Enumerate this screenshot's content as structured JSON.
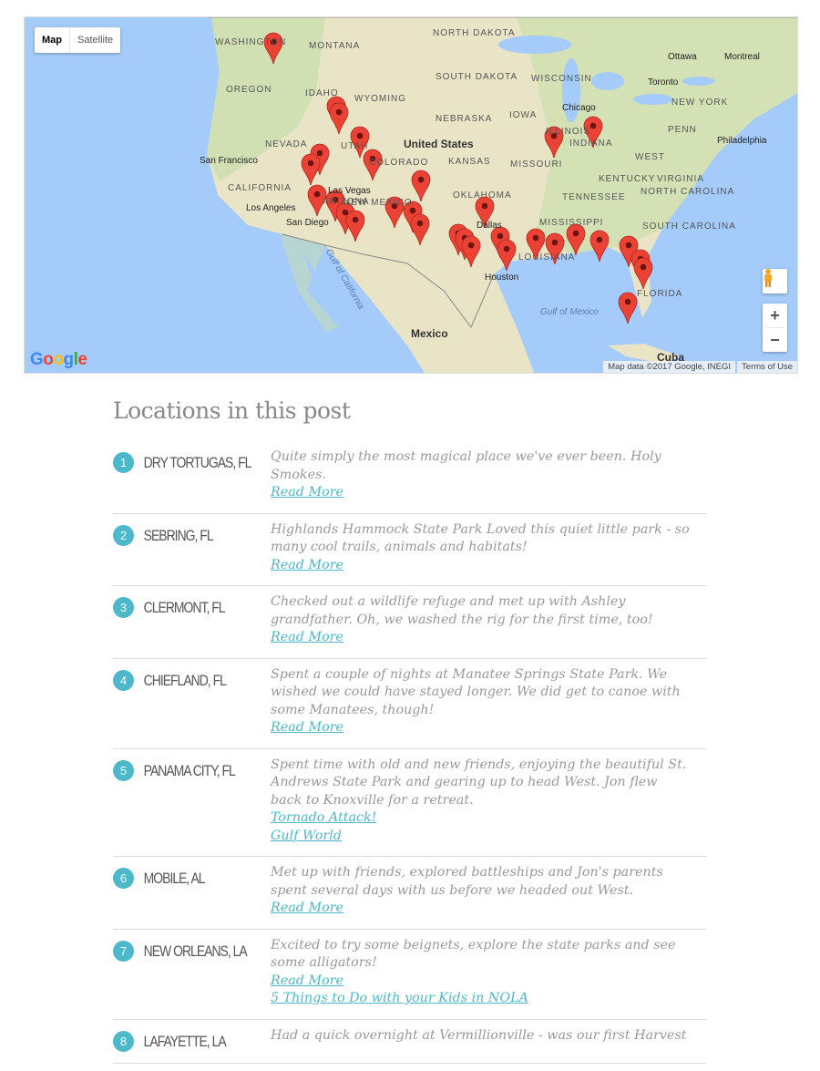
{
  "map": {
    "type_control": {
      "map_label": "Map",
      "satellite_label": "Satellite",
      "selected": "Map"
    },
    "labels": [
      "WASHINGTON",
      "MONTANA",
      "NORTH DAKOTA",
      "OREGON",
      "IDAHO",
      "SOUTH DAKOTA",
      "WYOMING",
      "NEBRASKA",
      "IOWA",
      "WISCONSIN",
      "NEVADA",
      "UTAH",
      "United States",
      "KANSAS",
      "MISSOURI",
      "ILLINOIS",
      "INDIANA",
      "PENN",
      "CALIFORNIA",
      "COLORADO",
      "KENTUCKY",
      "VIRGINIA",
      "WEST",
      "OKLAHOMA",
      "TENNESSEE",
      "NORTH CAROLINA",
      "NEW MEXICO",
      "ARIZONA",
      "MISSISSIPPI",
      "SOUTH CAROLINA",
      "LOUISIANA",
      "FLORIDA",
      "Mexico",
      "Cuba",
      "Gulf of Mexico",
      "Gulf of California",
      "NEW YORK",
      "Chicago",
      "Toronto",
      "Ottawa",
      "Montreal",
      "Philadelphia",
      "San Francisco",
      "Los Angeles",
      "San Diego",
      "Las Vegas",
      "Dallas",
      "Houston"
    ],
    "marker_count": 31,
    "marker_color": "#ea4335",
    "zoom_in_label": "+",
    "zoom_out_label": "−",
    "logo": "Google",
    "attribution": "Map data ©2017 Google, INEGI",
    "terms_label": "Terms of Use"
  },
  "section_title": "Locations in this post",
  "accent_color": "#4cb8c9",
  "locations": [
    {
      "number": "1",
      "name": "Dry Tortugas, FL",
      "description": "Quite simply the most magical place we've ever been. Holy Smokes.",
      "links": [
        "Read More"
      ]
    },
    {
      "number": "2",
      "name": "Sebring, FL",
      "description": "Highlands Hammock State Park Loved this quiet little park - so many cool trails, animals and habitats!",
      "links": [
        "Read More"
      ]
    },
    {
      "number": "3",
      "name": "Clermont, FL",
      "description": "Checked out a wildlife refuge and met up with Ashley grandfather. Oh, we washed the rig for the first time, too!",
      "links": [
        "Read More"
      ]
    },
    {
      "number": "4",
      "name": "Chiefland, FL",
      "description": "Spent a couple of nights at Manatee Springs State Park. We wished we could have stayed longer. We did get to canoe with some Manatees, though!",
      "links": [
        "Read More"
      ]
    },
    {
      "number": "5",
      "name": "Panama City, FL",
      "description": "Spent time with old and new friends, enjoying the beautiful St. Andrews State Park and gearing up to head West. Jon flew back to Knoxville for a retreat.",
      "links": [
        "Tornado Attack!",
        "Gulf World"
      ]
    },
    {
      "number": "6",
      "name": "Mobile, AL",
      "description": "Met up with friends, explored battleships and Jon's parents spent several days with us before we headed out West.",
      "links": [
        "Read More"
      ]
    },
    {
      "number": "7",
      "name": "New Orleans, LA",
      "description": "Excited to try some beignets, explore the state parks and see some alligators!",
      "links": [
        "Read More",
        "5 Things to Do with your Kids in NOLA"
      ]
    },
    {
      "number": "8",
      "name": "Lafayette, LA",
      "description": "Had a quick overnight at Vermillionville - was our first Harvest",
      "links": []
    }
  ]
}
